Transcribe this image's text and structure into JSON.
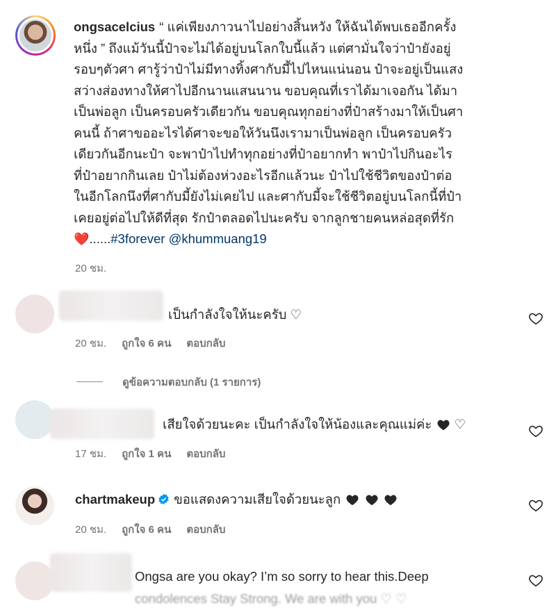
{
  "post": {
    "username": "ongsacelcius",
    "caption_text": "“ แค่เพียงภาวนาไปอย่างสิ้นหวัง ให้ฉันได้พบเธออีกครั้ง\nหนึ่ง ” ถึงแม้วันนี้ป๋าจะไม่ได้อยู่บนโลกใบนี้แล้ว แต่ศามั่นใจว่าป๋ายังอยู่\nรอบๆตัวศา ศารู้ว่าป๋าไม่มีทางทิ้งศากับมี้ไปไหนแน่นอน ป๋าจะอยู่เป็นแสง\nสว่างส่องทางให้ศาไปอีกนานแสนนาน ขอบคุณที่เราได้มาเจอกัน ได้มา\nเป็นพ่อลูก เป็นครอบครัวเดียวกัน ขอบคุณทุกอย่างที่ป๋าสร้างมาให้เป็นศา\nคนนี้ ถ้าศาขออะไรได้ศาจะขอให้วันนึงเรามาเป็นพ่อลูก เป็นครอบครัว\nเดียวกันอีกนะป๋า จะพาป๋าไปทำทุกอย่างที่ป๋าอยากทำ พาป๋าไปกินอะไร\nที่ป๋าอยากกินเลย ป๋าไม่ต้องห่วงอะไรอีกแล้วนะ ป๋าไปใช้ชีวิตของป๋าต่อ\nในอีกโลกนึงที่ศากับมี้ยังไม่เคยไป และศากับมี้จะใช้ชีวิตอยู่บนโลกนี้ที่ป๋า\nเคยอยู่ต่อไปให้ดีที่สุด รักป๋าตลอดไปนะครับ จากลูกชายคนหล่อสุดที่รัก",
    "caption_emoji": "❤️",
    "caption_dots": "......",
    "hashtag": "#3forever",
    "mention": "@khummuang19",
    "time": "20 ชม."
  },
  "comments": [
    {
      "text": "เป็นกำลังใจให้นะครับ ♡",
      "time": "20 ชม.",
      "likes": "ถูกใจ 6 คน",
      "reply": "ตอบกลับ",
      "view_replies": "ดูข้อความตอบกลับ (1 รายการ)"
    },
    {
      "text": "เสียใจด้วยนะคะ เป็นกำลังใจให้น้องและคุณแม่ค่ะ",
      "emoji_after": "♡",
      "time": "17 ชม.",
      "likes": "ถูกใจ 1 คน",
      "reply": "ตอบกลับ"
    },
    {
      "username": "chartmakeup",
      "text": "ขอแสดงความเสียใจด้วยนะลูก",
      "time": "20 ชม.",
      "likes": "ถูกใจ 6 คน",
      "reply": "ตอบกลับ"
    },
    {
      "text": "Ongsa are you okay? I’m so sorry to hear this.Deep",
      "text_line2_partial": "condolences Stay Strong. We are with you ♡ ♡"
    }
  ],
  "colors": {
    "text": "#262626",
    "secondary": "#737373",
    "link": "#00376b",
    "verified": "#0095f6",
    "heart_red": "#e0202e"
  },
  "icons": [
    "heart-outline-icon",
    "verified-badge-icon",
    "black-heart-icon"
  ]
}
